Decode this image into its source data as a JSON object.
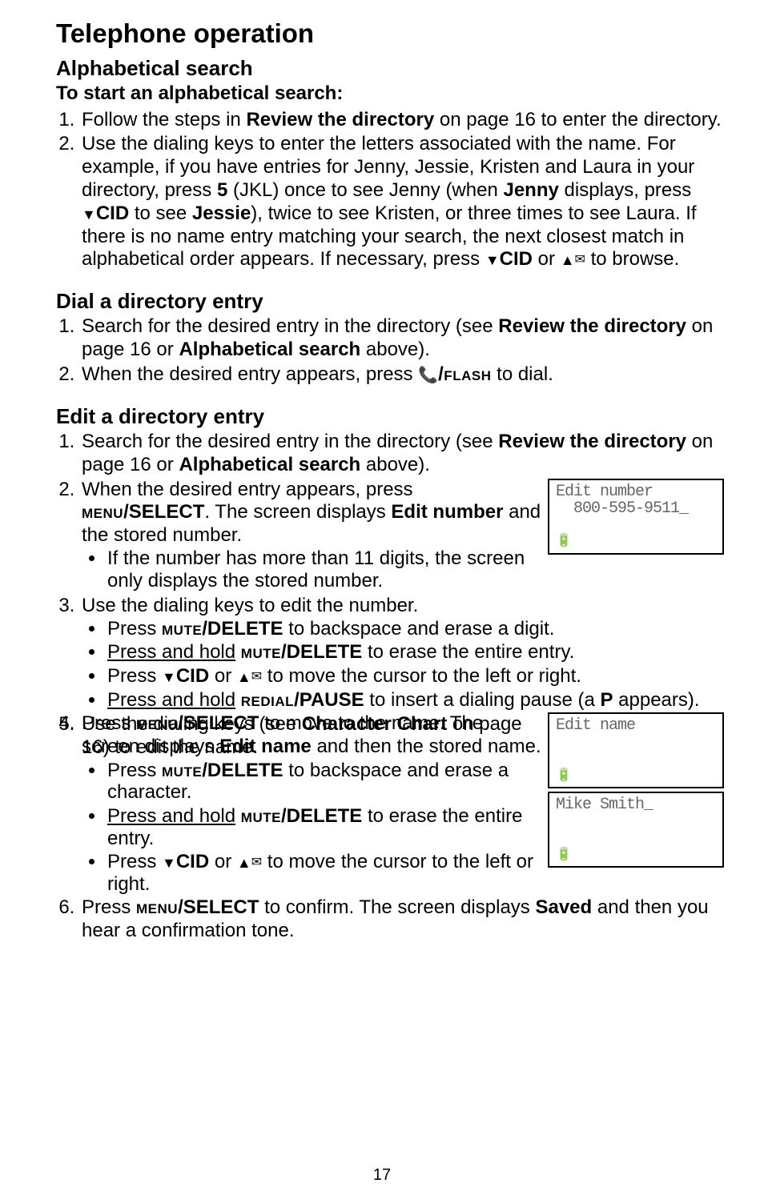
{
  "h1": "Telephone operation",
  "alpha": {
    "heading": "Alphabetical search",
    "sub": "To start an alphabetical search:",
    "s1": "Follow the steps in ",
    "s1b": "Review the directory",
    "s1c": " on page 16 to enter the directory.",
    "s2a": "Use the dialing keys to enter the letters associated with the name. For example, if you have entries for Jenny, Jessie, Kristen and Laura in your directory, press ",
    "s2_5": "5",
    "s2b": " (JKL) once to see Jenny (when ",
    "s2_jenny": "Jenny",
    "s2c": " displays, press ",
    "s2_cid": "CID",
    "s2d": " to see ",
    "s2_jessie": "Jessie",
    "s2e": "), twice to see Kristen, or three times to see Laura. If there is no name entry matching your search, the next closest match in alphabetical order appears. If necessary, press ",
    "s2f": " or ",
    "s2g": " to browse."
  },
  "dial": {
    "heading": "Dial a directory entry",
    "s1a": "Search for the desired entry in the directory (see ",
    "s1b": "Review the directory",
    "s1c": " on page 16 or ",
    "s1d": "Alphabetical search",
    "s1e": " above).",
    "s2a": "When the desired entry appears, press ",
    "s2_flash": "/flash",
    "s2b": " to dial."
  },
  "edit": {
    "heading": "Edit a directory entry",
    "s1a": "Search for the desired entry in the directory (see ",
    "s1b": "Review the directory",
    "s1c": " on page 16 or ",
    "s1d": "Alphabetical search",
    "s1e": " above).",
    "s2a": "When the desired entry appears, press ",
    "s2_menu": "menu",
    "s2_sel": "/SELECT",
    "s2b": ". The screen displays ",
    "s2_editnum": "Edit number",
    "s2c": " and the stored number.",
    "s2_bullet": "If the number has more than 11 digits, the screen only displays the stored number.",
    "s3": "Use the dialing keys to edit the number.",
    "s3_b1a": "Press ",
    "mute": "mute",
    "del": "/DELETE",
    "s3_b1b": " to backspace and erase a digit.",
    "s3_b2a": "Press and hold",
    "s3_b2b": " to erase the entire entry.",
    "s3_b3a": "Press ",
    "cid": "CID",
    "s3_b3b": " or ",
    "s3_b3c": " to move the cursor to the left or right.",
    "s3_b4a": "Press and hold",
    "redial": "redial",
    "pause": "/PAUSE",
    "s3_b4b": " to insert a dialing pause (a ",
    "s3_b4p": "P",
    "s3_b4c": " appears).",
    "s4a": "Press ",
    "s4b": " to move to the name. The screen displays ",
    "s4_editname": "Edit name",
    "s4c": " and then the stored name.",
    "s5a": "Use the dialing keys (see ",
    "s5_cc": "Character Chart",
    "s5b": " on page 16) to edit the name.",
    "s5_b1a": "Press ",
    "s5_b1b": " to backspace and erase a character.",
    "s5_b2a": "Press and hold",
    "s5_b2b": " to erase the entire entry.",
    "s5_b3a": "Press ",
    "s5_b3b": " or ",
    "s5_b3c": " to move the cursor to the left or right.",
    "s6a": "Press ",
    "s6b": " to confirm. The screen displays ",
    "s6_saved": "Saved",
    "s6c": " and then you hear a confirmation tone."
  },
  "lcd1": {
    "l1": "Edit number",
    "l2": "  800-595-9511_"
  },
  "lcd2": {
    "l1": "Edit name"
  },
  "lcd3": {
    "l1": "Mike Smith_"
  },
  "pagenum": "17"
}
